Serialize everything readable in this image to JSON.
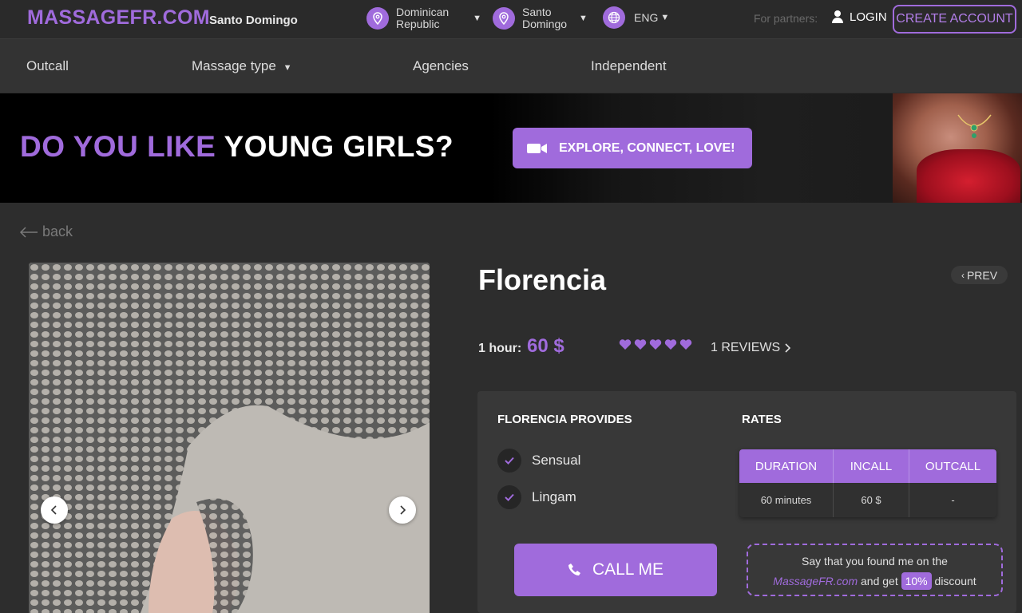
{
  "header": {
    "logo": "MASSAGEFR.COM",
    "city": "Santo Domingo",
    "country_line1": "Dominican",
    "country_line2": "Republic",
    "city_line1": "Santo",
    "city_line2": "Domingo",
    "language": "ENG",
    "partners_label": "For partners:",
    "login_label": "LOGIN",
    "create_account_label": "CREATE ACCOUNT"
  },
  "nav": {
    "outcall": "Outcall",
    "massage_type": "Massage type",
    "agencies": "Agencies",
    "independent": "Independent"
  },
  "banner": {
    "text_purple": "DO YOU LIKE ",
    "text_white": "YOUNG GIRLS?",
    "button_label": "EXPLORE, CONNECT, LOVE!"
  },
  "back_label": "back",
  "profile": {
    "name": "Florencia",
    "prev_label": "PREV",
    "price_label": "1 hour:",
    "price_value": "60 $",
    "rating_hearts": 5,
    "reviews_label": "1 REVIEWS"
  },
  "provides": {
    "title": "FLORENCIA PROVIDES",
    "services": [
      "Sensual",
      "Lingam"
    ]
  },
  "rates": {
    "title": "RATES",
    "headers": [
      "DURATION",
      "INCALL",
      "OUTCALL"
    ],
    "rows": [
      [
        "60 minutes",
        "60 $",
        "-"
      ]
    ]
  },
  "call_label": "CALL ME",
  "discount": {
    "line1": "Say that you found me on the",
    "site": "MassageFR.com",
    "and_get": " and get ",
    "percent": "10%",
    "suffix": " discount"
  },
  "colors": {
    "accent": "#a06bdc",
    "background": "#2d2d2d",
    "panel": "#383838"
  }
}
